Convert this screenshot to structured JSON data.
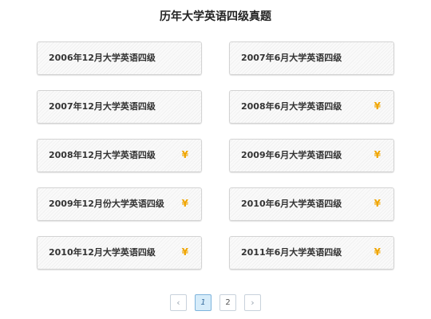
{
  "page": {
    "title": "历年大学英语四级真题"
  },
  "papers": {
    "items": [
      {
        "label": "2006年12月大学英语四级",
        "badge": ""
      },
      {
        "label": "2007年6月大学英语四级",
        "badge": ""
      },
      {
        "label": "2007年12月大学英语四级",
        "badge": ""
      },
      {
        "label": "2008年6月大学英语四级",
        "badge": "¥"
      },
      {
        "label": "2008年12月大学英语四级",
        "badge": "¥"
      },
      {
        "label": "2009年6月大学英语四级",
        "badge": "¥"
      },
      {
        "label": "2009年12月份大学英语四级",
        "badge": "¥"
      },
      {
        "label": "2010年6月大学英语四级",
        "badge": "¥"
      },
      {
        "label": "2010年12月大学英语四级",
        "badge": "¥"
      },
      {
        "label": "2011年6月大学英语四级",
        "badge": "¥"
      }
    ]
  },
  "pagination": {
    "prev": "‹",
    "pages": [
      "1",
      "2"
    ],
    "current": "1",
    "next": "›"
  },
  "colors": {
    "badge": "#f0a500",
    "active_page_bg": "#d6ecfa"
  }
}
